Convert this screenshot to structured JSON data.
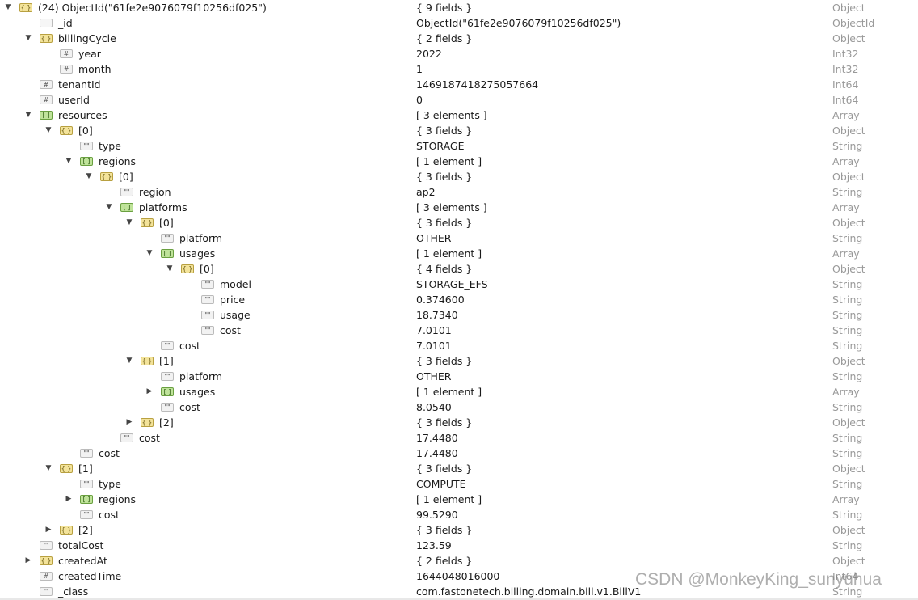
{
  "rows": [
    {
      "level": 0,
      "exp": "open",
      "icon": "obj",
      "key": "(24) ObjectId(\"61fe2e9076079f10256df025\")",
      "value": "{ 9 fields }",
      "type": "Object"
    },
    {
      "level": 1,
      "exp": "",
      "icon": "id",
      "key": "_id",
      "value": "ObjectId(\"61fe2e9076079f10256df025\")",
      "type": "ObjectId"
    },
    {
      "level": 1,
      "exp": "open",
      "icon": "obj",
      "key": "billingCycle",
      "value": "{ 2 fields }",
      "type": "Object"
    },
    {
      "level": 2,
      "exp": "",
      "icon": "num",
      "key": "year",
      "value": "2022",
      "type": "Int32"
    },
    {
      "level": 2,
      "exp": "",
      "icon": "num",
      "key": "month",
      "value": "1",
      "type": "Int32"
    },
    {
      "level": 1,
      "exp": "",
      "icon": "num",
      "key": "tenantId",
      "value": "1469187418275057664",
      "type": "Int64"
    },
    {
      "level": 1,
      "exp": "",
      "icon": "num",
      "key": "userId",
      "value": "0",
      "type": "Int64"
    },
    {
      "level": 1,
      "exp": "open",
      "icon": "arr",
      "key": "resources",
      "value": "[ 3 elements ]",
      "type": "Array"
    },
    {
      "level": 2,
      "exp": "open",
      "icon": "obj",
      "key": "[0]",
      "value": "{ 3 fields }",
      "type": "Object"
    },
    {
      "level": 3,
      "exp": "",
      "icon": "str",
      "key": "type",
      "value": "STORAGE",
      "type": "String"
    },
    {
      "level": 3,
      "exp": "open",
      "icon": "arr",
      "key": "regions",
      "value": "[ 1 element ]",
      "type": "Array"
    },
    {
      "level": 4,
      "exp": "open",
      "icon": "obj",
      "key": "[0]",
      "value": "{ 3 fields }",
      "type": "Object"
    },
    {
      "level": 5,
      "exp": "",
      "icon": "str",
      "key": "region",
      "value": "ap2",
      "type": "String"
    },
    {
      "level": 5,
      "exp": "open",
      "icon": "arr",
      "key": "platforms",
      "value": "[ 3 elements ]",
      "type": "Array"
    },
    {
      "level": 6,
      "exp": "open",
      "icon": "obj",
      "key": "[0]",
      "value": "{ 3 fields }",
      "type": "Object"
    },
    {
      "level": 7,
      "exp": "",
      "icon": "str",
      "key": "platform",
      "value": "OTHER",
      "type": "String"
    },
    {
      "level": 7,
      "exp": "open",
      "icon": "arr",
      "key": "usages",
      "value": "[ 1 element ]",
      "type": "Array"
    },
    {
      "level": 8,
      "exp": "open",
      "icon": "obj",
      "key": "[0]",
      "value": "{ 4 fields }",
      "type": "Object"
    },
    {
      "level": 9,
      "exp": "",
      "icon": "str",
      "key": "model",
      "value": "STORAGE_EFS",
      "type": "String"
    },
    {
      "level": 9,
      "exp": "",
      "icon": "str",
      "key": "price",
      "value": "0.374600",
      "type": "String"
    },
    {
      "level": 9,
      "exp": "",
      "icon": "str",
      "key": "usage",
      "value": "18.7340",
      "type": "String"
    },
    {
      "level": 9,
      "exp": "",
      "icon": "str",
      "key": "cost",
      "value": "7.0101",
      "type": "String"
    },
    {
      "level": 7,
      "exp": "",
      "icon": "str",
      "key": "cost",
      "value": "7.0101",
      "type": "String"
    },
    {
      "level": 6,
      "exp": "open",
      "icon": "obj",
      "key": "[1]",
      "value": "{ 3 fields }",
      "type": "Object"
    },
    {
      "level": 7,
      "exp": "",
      "icon": "str",
      "key": "platform",
      "value": "OTHER",
      "type": "String"
    },
    {
      "level": 7,
      "exp": "closed",
      "icon": "arr",
      "key": "usages",
      "value": "[ 1 element ]",
      "type": "Array"
    },
    {
      "level": 7,
      "exp": "",
      "icon": "str",
      "key": "cost",
      "value": "8.0540",
      "type": "String"
    },
    {
      "level": 6,
      "exp": "closed",
      "icon": "obj",
      "key": "[2]",
      "value": "{ 3 fields }",
      "type": "Object"
    },
    {
      "level": 5,
      "exp": "",
      "icon": "str",
      "key": "cost",
      "value": "17.4480",
      "type": "String"
    },
    {
      "level": 3,
      "exp": "",
      "icon": "str",
      "key": "cost",
      "value": "17.4480",
      "type": "String"
    },
    {
      "level": 2,
      "exp": "open",
      "icon": "obj",
      "key": "[1]",
      "value": "{ 3 fields }",
      "type": "Object"
    },
    {
      "level": 3,
      "exp": "",
      "icon": "str",
      "key": "type",
      "value": "COMPUTE",
      "type": "String"
    },
    {
      "level": 3,
      "exp": "closed",
      "icon": "arr",
      "key": "regions",
      "value": "[ 1 element ]",
      "type": "Array"
    },
    {
      "level": 3,
      "exp": "",
      "icon": "str",
      "key": "cost",
      "value": "99.5290",
      "type": "String"
    },
    {
      "level": 2,
      "exp": "closed",
      "icon": "obj",
      "key": "[2]",
      "value": "{ 3 fields }",
      "type": "Object"
    },
    {
      "level": 1,
      "exp": "",
      "icon": "str",
      "key": "totalCost",
      "value": "123.59",
      "type": "String"
    },
    {
      "level": 1,
      "exp": "closed",
      "icon": "obj",
      "key": "createdAt",
      "value": "{ 2 fields }",
      "type": "Object"
    },
    {
      "level": 1,
      "exp": "",
      "icon": "num",
      "key": "createdTime",
      "value": "1644048016000",
      "type": "Int64"
    },
    {
      "level": 1,
      "exp": "",
      "icon": "str",
      "key": "_class",
      "value": "com.fastonetech.billing.domain.bill.v1.BillV1",
      "type": "String"
    }
  ],
  "icon_glyphs": {
    "obj": "{ }",
    "arr": "[ ]",
    "num": "#",
    "str": "\"\"",
    "id": ""
  },
  "watermark": "CSDN @MonkeyKing_sunyuhua"
}
